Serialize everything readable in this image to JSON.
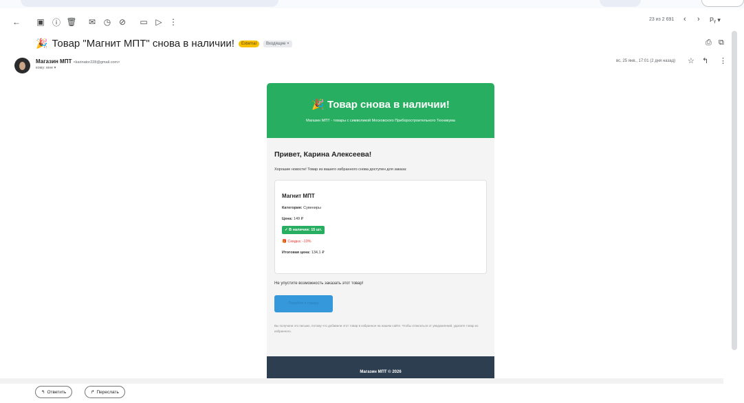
{
  "toolbar": {
    "icons": [
      "back-arrow-icon",
      "archive-icon",
      "report-spam-icon",
      "delete-icon",
      "mark-unread-icon",
      "snooze-icon",
      "add-task-icon",
      "move-to-icon",
      "label-icon",
      "more-vert-icon"
    ]
  },
  "pager": {
    "text": "23 из 2 691"
  },
  "header": {
    "subject": "Товар \"Магнит МПТ\" снова в наличии!",
    "label_external": "External",
    "label_inbox": "Входящие ×"
  },
  "sender": {
    "name": "Магазин МПТ",
    "email": "<karinator228@gmail.com>",
    "to": "кому: мне ▾",
    "date": "вс, 25 янв., 17:01 (2 дня назад)"
  },
  "mail": {
    "title": "Товар снова в наличии!",
    "subtitle": "Магазин МПТ - товары с символикой Московского Приборостроительного Техникума",
    "greeting": "Привет, Карина Алексеева!",
    "intro": "Хорошие новости! Товар из вашего избранного снова доступен для заказа:",
    "product": {
      "name": "Магнит МПТ",
      "category_label": "Категория:",
      "category": "Сувениры",
      "price_label": "Цена:",
      "price": "149 ₽",
      "stock": "✓ В наличии: 15 шт.",
      "discount": "Скидка: -10%",
      "final_label": "Итоговая цена:",
      "final": "134,1 ₽"
    },
    "cta_text": "Не упустите возможность заказать этот товар!",
    "cta_button": "Перейти к товару",
    "fine_print": "Вы получили это письмо, потому что добавили этот товар в избранное на нашем сайте. Чтобы отписаться от уведомлений, удалите товар из избранного.",
    "footer": "Магазин МПТ © 2026"
  },
  "actions": {
    "reply": "Ответить",
    "forward": "Переслать"
  },
  "colors": {
    "header_green": "#27ae60",
    "footer_dark": "#2c3e50",
    "button_blue": "#3498db"
  }
}
